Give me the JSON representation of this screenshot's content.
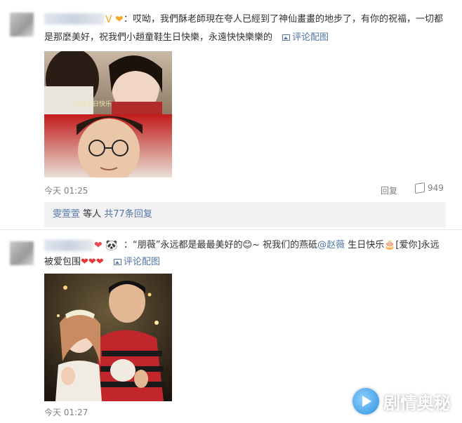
{
  "comment1": {
    "badges": "V ❤",
    "line1": "：哎呦，我們酥老師現在夸人已經到了神仙畫畫的地步了，有你的祝福，一切都",
    "line2": "是那麼美好，祝我們小趙童鞋生日快樂，永遠快快樂樂的",
    "pic_link": "评论配图",
    "time": "今天 01:25",
    "reply": "回复",
    "likes": "949",
    "sub_names": "雯萱萱",
    "sub_mid": " 等人 ",
    "sub_count": "共77条回复"
  },
  "comment2": {
    "badges": "❤ 🐼",
    "text_a": "：“朋薇”永远都是最最美好的",
    "emoji1": "😊",
    "text_b": "~ 祝我们的燕砥",
    "mention": "@赵薇",
    "text_c": " 生日快乐",
    "cake": "🎂",
    "text_d": "[爱你]永远",
    "line2": "被爱包围",
    "hearts": "❤❤❤",
    "pic_link": "评论配图",
    "time": "今天 01:27"
  },
  "watermark": "剧情奥秘",
  "photo1_caption": "赵薇生日快乐"
}
